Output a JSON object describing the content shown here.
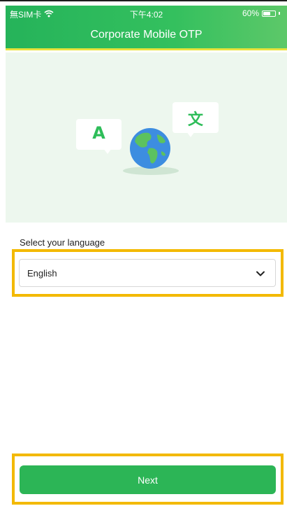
{
  "status_bar": {
    "carrier": "無SIM卡",
    "time": "下午4:02",
    "battery": "60%",
    "battery_level": 0.6
  },
  "header": {
    "title": "Corporate Mobile OTP"
  },
  "hero": {
    "bubble_left_text": "A",
    "bubble_right_text": "文",
    "globe_icon": "globe-icon"
  },
  "language": {
    "label": "Select your language",
    "selected": "English"
  },
  "actions": {
    "next_label": "Next"
  },
  "colors": {
    "brand_green": "#2cb556",
    "highlight": "#f3b900",
    "header_underline": "#e8e23c",
    "hero_bg": "#edf7ee"
  }
}
